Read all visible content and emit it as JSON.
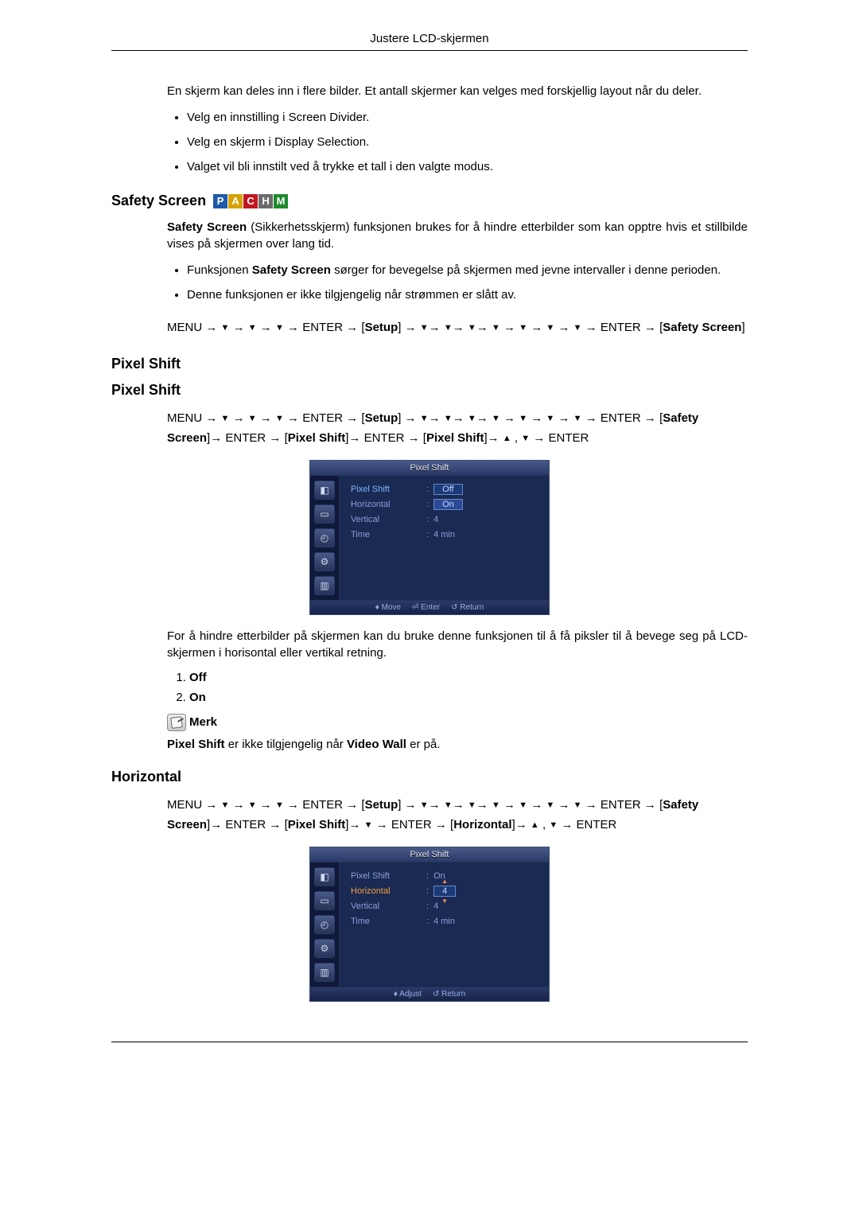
{
  "header": {
    "title": "Justere LCD-skjermen"
  },
  "intro": {
    "para": "En skjerm kan deles inn i flere bilder. Et antall skjermer kan velges med forskjellig layout når du deler.",
    "bullets": [
      "Velg en innstilling i Screen Divider.",
      "Velg en skjerm i Display Selection.",
      "Valget vil bli innstilt ved å trykke et tall i den valgte modus."
    ]
  },
  "safety": {
    "heading": "Safety Screen",
    "badges": [
      "P",
      "A",
      "C",
      "H",
      "M"
    ],
    "para_bold": "Safety Screen",
    "para_rest": " (Sikkerhetsskjerm) funksjonen brukes for å hindre etterbilder som kan opptre hvis et stillbilde vises på skjermen over lang tid.",
    "bullets": [
      "Funksjonen Safety Screen sørger for bevegelse på skjermen med jevne intervaller i denne perioden.",
      "Denne funksjonen er ikke tilgjengelig når strømmen er slått av."
    ],
    "bullet0_prefix": "Funksjonen ",
    "bullet0_bold": "Safety Screen",
    "bullet0_suffix": " sørger for bevegelse på skjermen med jevne intervaller i denne perioden.",
    "nav": {
      "menu": "MENU",
      "enter": "ENTER",
      "setup": "Setup",
      "safety": "Safety Screen"
    }
  },
  "pixelshift": {
    "heading1": "Pixel Shift",
    "heading2": "Pixel Shift",
    "nav": {
      "menu": "MENU",
      "enter": "ENTER",
      "setup": "Setup",
      "safety": "Safety Screen",
      "pixel": "Pixel Shift",
      "pixel2": "Pixel Shift"
    },
    "osd": {
      "title": "Pixel Shift",
      "rows": {
        "pixelShiftLabel": "Pixel Shift",
        "horizontalLabel": "Horizontal",
        "verticalLabel": "Vertical",
        "timeLabel": "Time",
        "valOff": "Off",
        "valOn": "On",
        "val4": "4",
        "val4min": "4 min"
      },
      "foot": {
        "move": "Move",
        "enter": "Enter",
        "return": "Return"
      }
    },
    "desc": "For å hindre etterbilder på skjermen kan du bruke denne funksjonen til å få piksler til å bevege seg på LCD-skjermen i horisontal eller vertikal retning.",
    "options": [
      "Off",
      "On"
    ],
    "noteLabel": "Merk",
    "noteText_pre": "Pixel Shift",
    "noteText_mid": " er ikke tilgjengelig når ",
    "noteText_bold2": "Video Wall",
    "noteText_suf": " er på."
  },
  "horizontal": {
    "heading": "Horizontal",
    "nav": {
      "menu": "MENU",
      "enter": "ENTER",
      "setup": "Setup",
      "safety": "Safety Screen",
      "pixel": "Pixel Shift",
      "horiz": "Horizontal"
    },
    "osd": {
      "title": "Pixel Shift",
      "rows": {
        "pixelShiftLabel": "Pixel Shift",
        "horizontalLabel": "Horizontal",
        "verticalLabel": "Vertical",
        "timeLabel": "Time",
        "valOn": "On",
        "val4box": "4",
        "val4": "4",
        "val4min": "4 min"
      },
      "foot": {
        "adjust": "Adjust",
        "return": "Return"
      }
    }
  }
}
